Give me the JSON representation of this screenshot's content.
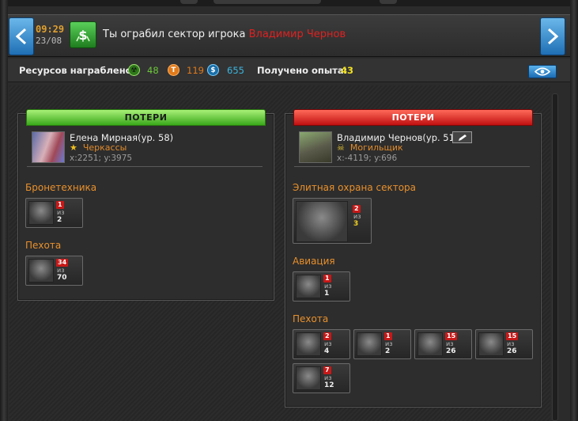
{
  "header": {
    "time": "09:29",
    "date": "23/08",
    "event_text": "Ты ограбил сектор игрока ",
    "enemy_name": "Владимир Чернов"
  },
  "resources": {
    "label": "Ресурсов награблено:",
    "items": [
      {
        "icon": "radiation-icon",
        "value": "48",
        "color": "#6cc83a"
      },
      {
        "icon": "titanium-icon",
        "value": "119",
        "color": "#e07a1a"
      },
      {
        "icon": "credits-icon",
        "value": "655",
        "color": "#3ab6e0"
      }
    ],
    "xp_label": "Получено опыта:",
    "xp_value": "43"
  },
  "left_panel": {
    "banner": "ПОТЕРИ",
    "player_name": "Елена Мирная(ур. 58)",
    "city": "Черкассы",
    "coords": "x:2251; y:3975",
    "sections": [
      {
        "title": "Бронетехника",
        "units": [
          {
            "lost": "1",
            "of": "из",
            "total": "2"
          }
        ]
      },
      {
        "title": "Пехота",
        "units": [
          {
            "lost": "34",
            "of": "из",
            "total": "70"
          }
        ]
      }
    ]
  },
  "right_panel": {
    "banner": "ПОТЕРИ",
    "player_name": "Владимир Чернов(ур. 51)",
    "city": "Могильщик",
    "coords": "x:-4119; y:696",
    "sections": [
      {
        "title": "Элитная охрана сектора",
        "units": [
          {
            "lost": "2",
            "of": "из",
            "total": "3"
          }
        ]
      },
      {
        "title": "Авиация",
        "units": [
          {
            "lost": "1",
            "of": "из",
            "total": "1"
          }
        ]
      },
      {
        "title": "Пехота",
        "units": [
          {
            "lost": "2",
            "of": "из",
            "total": "4"
          },
          {
            "lost": "1",
            "of": "из",
            "total": "2"
          },
          {
            "lost": "15",
            "of": "из",
            "total": "26"
          },
          {
            "lost": "15",
            "of": "из",
            "total": "26"
          },
          {
            "lost": "7",
            "of": "из",
            "total": "12"
          }
        ]
      }
    ]
  }
}
